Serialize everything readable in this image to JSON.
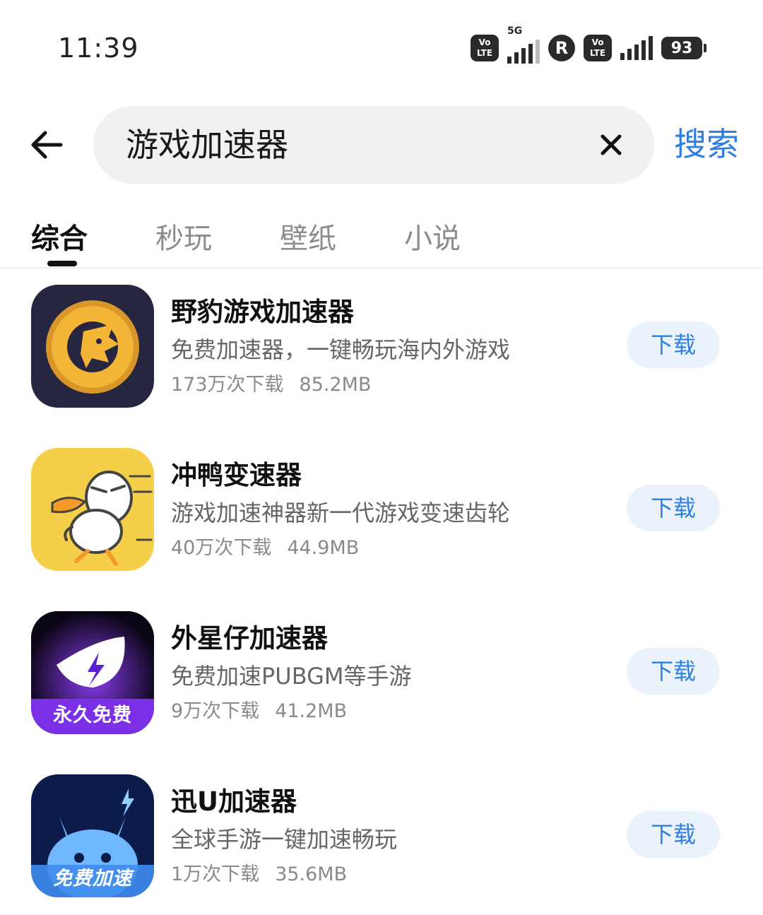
{
  "status_bar": {
    "time": "11:39",
    "volte_label": "Vo LTE",
    "network_5g": "5G",
    "roaming": "R",
    "battery": "93"
  },
  "search": {
    "query": "游戏加速器",
    "submit_label": "搜索"
  },
  "tabs": [
    {
      "label": "综合",
      "active": true
    },
    {
      "label": "秒玩",
      "active": false
    },
    {
      "label": "壁纸",
      "active": false
    },
    {
      "label": "小说",
      "active": false
    }
  ],
  "apps": [
    {
      "name": "野豹游戏加速器",
      "description": "免费加速器，一键畅玩海内外游戏",
      "downloads": "173万次下载",
      "size": "85.2MB",
      "button": "下载",
      "icon": "leopard-icon"
    },
    {
      "name": "冲鸭变速器",
      "description": "游戏加速神器新一代游戏变速齿轮",
      "downloads": "40万次下载",
      "size": "44.9MB",
      "button": "下载",
      "icon": "running-duck-icon"
    },
    {
      "name": "外星仔加速器",
      "description": "免费加速PUBGM等手游",
      "downloads": "9万次下载",
      "size": "41.2MB",
      "button": "下载",
      "icon": "alien-eye-icon",
      "badge": "永久免费"
    },
    {
      "name": "迅U加速器",
      "description": "全球手游一键加速畅玩",
      "downloads": "1万次下载",
      "size": "35.6MB",
      "button": "下载",
      "icon": "blue-cat-icon",
      "badge": "免费加速"
    }
  ],
  "colors": {
    "accent": "#2f7fe0",
    "button_bg": "#eaf2fc",
    "search_bg": "#f1f1f1"
  }
}
